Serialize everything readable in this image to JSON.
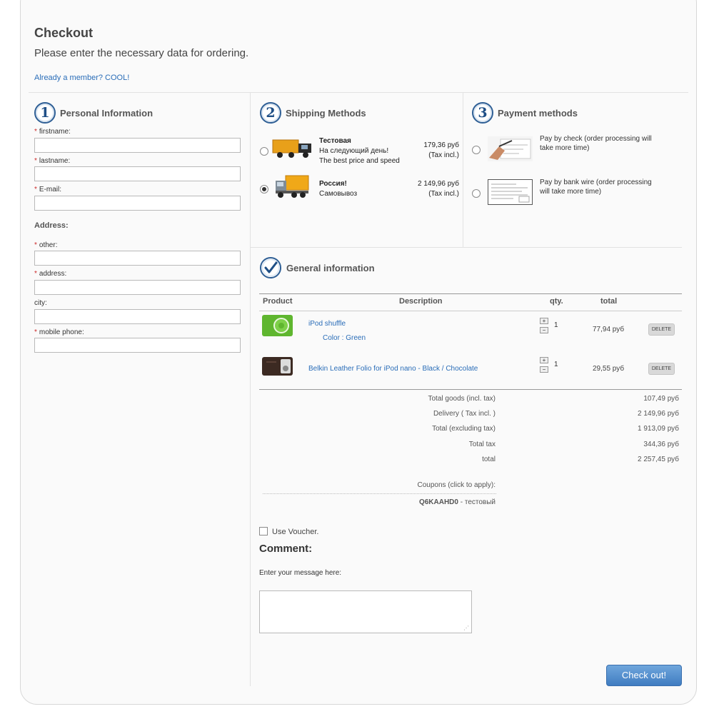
{
  "header": {
    "title": "Checkout",
    "subtitle": "Please enter the necessary data for ordering.",
    "member_link": "Already a member? COOL!"
  },
  "personal": {
    "step": "1",
    "title": "Personal Information",
    "fields": {
      "firstname": "firstname:",
      "lastname": "lastname:",
      "email": "E-mail:"
    },
    "address_title": "Address:",
    "address_fields": {
      "other": "other:",
      "address": "address:",
      "city": "city:",
      "mobile": "mobile phone:"
    },
    "required_mark": "*"
  },
  "shipping": {
    "step": "2",
    "title": "Shipping Methods",
    "methods": [
      {
        "name": "Тестовая",
        "line1": "На следующий день!",
        "line2": "The best price and speed",
        "price": "179,36 руб",
        "tax": "(Tax incl.)",
        "selected": false
      },
      {
        "name": "Россия!",
        "line1": "Самовывоз",
        "line2": "",
        "price": "2 149,96 руб",
        "tax": "(Tax incl.)",
        "selected": true
      }
    ],
    "icon": "delivery-truck-icon"
  },
  "payment": {
    "step": "3",
    "title": "Payment methods",
    "methods": [
      {
        "label": "Pay by check (order processing will take more time)",
        "icon": "cheque-icon"
      },
      {
        "label": "Pay by bank wire (order processing will take more time)",
        "icon": "bank-wire-icon"
      }
    ]
  },
  "general": {
    "title": "General information",
    "icon": "checkmark-circle-icon",
    "columns": {
      "product": "Product",
      "description": "Description",
      "qty": "qty.",
      "total": "total"
    },
    "items": [
      {
        "name": "iPod shuffle",
        "attr": "Color : Green",
        "qty": "1",
        "total": "77,94 руб",
        "delete": "DELETE"
      },
      {
        "name": "Belkin Leather Folio for iPod nano - Black / Chocolate",
        "attr": "",
        "qty": "1",
        "total": "29,55 руб",
        "delete": "DELETE"
      }
    ],
    "summary": [
      {
        "label": "Total goods (incl. tax)",
        "value": "107,49 руб"
      },
      {
        "label": "Delivery ( Tax incl. )",
        "value": "2 149,96 руб"
      },
      {
        "label": "Total (excluding tax)",
        "value": "1 913,09 руб"
      },
      {
        "label": "Total tax",
        "value": "344,36 руб"
      },
      {
        "label": "total",
        "value": "2 257,45 руб"
      }
    ],
    "coupons_label": "Coupons (click to apply):",
    "coupon_code": "Q6KAAHD0",
    "coupon_name": " - тестовый"
  },
  "voucher": {
    "label": "Use Voucher."
  },
  "comment": {
    "title": "Comment:",
    "prompt": "Enter your message here:",
    "value": ""
  },
  "checkout_button": "Check out!",
  "colors": {
    "accent": "#2a6db8",
    "button": "#4a86c8",
    "required": "#cc2a2a"
  }
}
